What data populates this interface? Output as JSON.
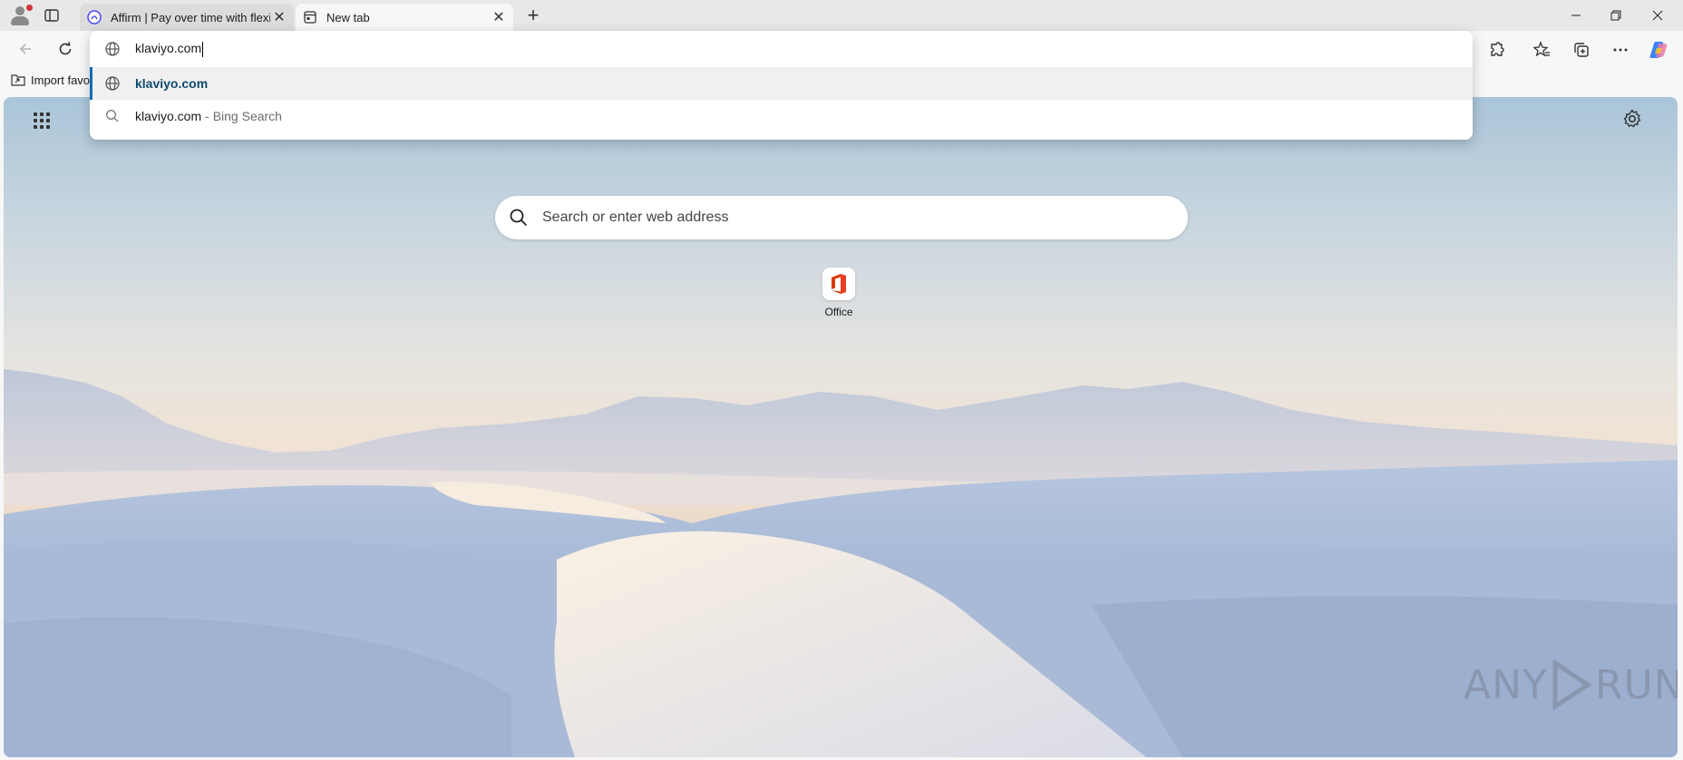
{
  "tabs": [
    {
      "title": "Affirm | Pay over time with flexibl",
      "active": false,
      "icon": "affirm-icon"
    },
    {
      "title": "New tab",
      "active": true,
      "icon": "newtab-page-icon"
    }
  ],
  "toolbar": {
    "back_icon": "back-arrow-icon",
    "refresh_icon": "refresh-icon"
  },
  "address_bar": {
    "value": "klaviyo.com"
  },
  "omnibox_suggestions": [
    {
      "text": "klaviyo.com",
      "sub": "",
      "icon": "globe-icon",
      "selected": true
    },
    {
      "text": "klaviyo.com",
      "sub": "- Bing Search",
      "icon": "search-icon",
      "selected": false
    }
  ],
  "favorites_bar": {
    "import_label": "Import favor"
  },
  "newtab": {
    "search_placeholder": "Search or enter web address",
    "tiles": [
      {
        "label": "Office",
        "icon": "office-icon"
      }
    ]
  },
  "watermark": {
    "left": "ANY",
    "right": "RUN"
  },
  "colors": {
    "accent": "#0f6cbd",
    "selected_text": "#0e4b6f"
  }
}
